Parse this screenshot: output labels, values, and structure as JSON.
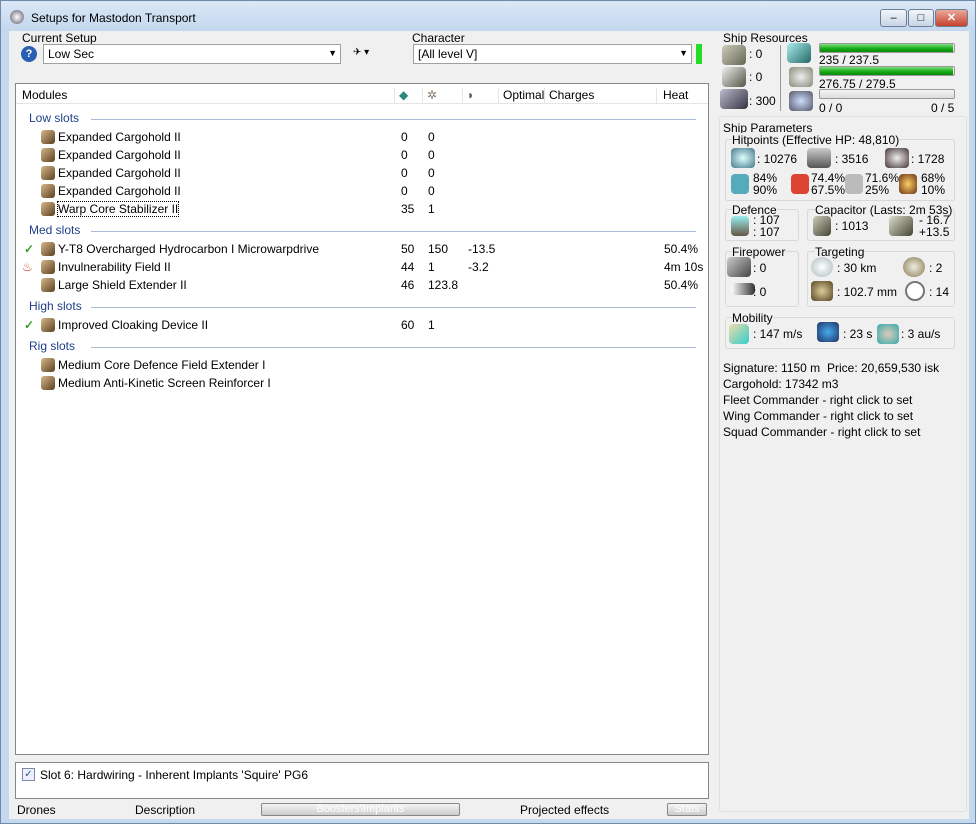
{
  "window": {
    "title": "Setups for Mastodon Transport",
    "buttons": [
      "minimize",
      "maximize",
      "close"
    ]
  },
  "setup": {
    "label": "Current Setup",
    "value": "Low Sec"
  },
  "character": {
    "label": "Character",
    "value": "[All level V]",
    "status_color": "#22dd22"
  },
  "modules": {
    "headers": {
      "name": "Modules",
      "cpu_icon": "cpu-icon",
      "pg_icon": "powergrid-icon",
      "cap_icon": "capacitor-icon",
      "optimal": "Optimal",
      "charges": "Charges",
      "heat": "Heat"
    },
    "groups": [
      {
        "title": "Low slots",
        "items": [
          {
            "name": "Expanded Cargohold II",
            "cpu": "0",
            "pg": "0",
            "cap": "",
            "heat": "",
            "state": ""
          },
          {
            "name": "Expanded Cargohold II",
            "cpu": "0",
            "pg": "0",
            "cap": "",
            "heat": "",
            "state": ""
          },
          {
            "name": "Expanded Cargohold II",
            "cpu": "0",
            "pg": "0",
            "cap": "",
            "heat": "",
            "state": ""
          },
          {
            "name": "Expanded Cargohold II",
            "cpu": "0",
            "pg": "0",
            "cap": "",
            "heat": "",
            "state": ""
          },
          {
            "name": "Warp Core Stabilizer II",
            "cpu": "35",
            "pg": "1",
            "cap": "",
            "heat": "",
            "state": "",
            "focused": true
          }
        ]
      },
      {
        "title": "Med slots",
        "items": [
          {
            "name": "Y-T8 Overcharged Hydrocarbon I Microwarpdrive",
            "cpu": "50",
            "pg": "150",
            "cap": "-13.5",
            "heat": "50.4%",
            "state": "active"
          },
          {
            "name": "Invulnerability Field II",
            "cpu": "44",
            "pg": "1",
            "cap": "-3.2",
            "heat": "4m 10s",
            "state": "overheated"
          },
          {
            "name": "Large Shield Extender II",
            "cpu": "46",
            "pg": "123.8",
            "cap": "",
            "heat": "50.4%",
            "state": ""
          }
        ]
      },
      {
        "title": "High slots",
        "items": [
          {
            "name": "Improved Cloaking Device II",
            "cpu": "60",
            "pg": "1",
            "cap": "",
            "heat": "",
            "state": "active"
          }
        ]
      },
      {
        "title": "Rig slots",
        "items": [
          {
            "name": "Medium Core Defence Field Extender I",
            "cpu": "",
            "pg": "",
            "cap": "",
            "heat": "",
            "state": ""
          },
          {
            "name": "Medium Anti-Kinetic Screen Reinforcer I",
            "cpu": "",
            "pg": "",
            "cap": "",
            "heat": "",
            "state": ""
          }
        ]
      }
    ]
  },
  "implants": {
    "items": [
      {
        "label": "Slot 6: Hardwiring - Inherent Implants 'Squire' PG6",
        "checked": true
      }
    ]
  },
  "bottom_tabs": [
    "Drones",
    "Description",
    "Boosters\\Implants",
    "Projected effects",
    "Stats"
  ],
  "resources": {
    "title": "Ship Resources",
    "turret": ": 0",
    "launcher": ": 0",
    "drone_bay": ": 300",
    "cpu": {
      "text": "235 / 237.5",
      "fill": 0.989
    },
    "pg": {
      "text": "276.75 / 279.5",
      "fill": 0.99
    },
    "drones": {
      "text": "0 / 0",
      "text2": "0 / 5",
      "fill": 0
    }
  },
  "params": {
    "title": "Ship Parameters",
    "hp": {
      "title": "Hitpoints (Effective HP: 48,810)",
      "shield": ": 10276",
      "armor": ": 3516",
      "structure": ": 1728",
      "res": [
        {
          "a": "84%",
          "b": "90%"
        },
        {
          "a": "74.4%",
          "b": "67.5%"
        },
        {
          "a": "71.6%",
          "b": "25%"
        },
        {
          "a": "68%",
          "b": "10%"
        }
      ]
    },
    "defence": {
      "title": "Defence",
      "a": ": 107",
      "b": ": 107"
    },
    "capacitor": {
      "title": "Capacitor (Lasts: 2m 53s)",
      "cap": ": 1013",
      "a": "- 16.7",
      "b": "+13.5"
    },
    "firepower": {
      "title": "Firepower",
      "a": ": 0",
      "b": ": 0"
    },
    "targeting": {
      "title": "Targeting",
      "range": ": 30 km",
      "targets": ": 2",
      "scan": ": 102.7 mm",
      "sensor": ": 14"
    },
    "mobility": {
      "title": "Mobility",
      "speed": ": 147 m/s",
      "align": ": 23 s",
      "warp": ": 3 au/s"
    },
    "signature": "Signature: 1150 m",
    "price": "Price: 20,659,530 isk",
    "cargohold": "Cargohold: 17342 m3",
    "fleet": "Fleet Commander - right click to set",
    "wing": "Wing Commander - right click to set",
    "squad": "Squad Commander - right click to set"
  }
}
